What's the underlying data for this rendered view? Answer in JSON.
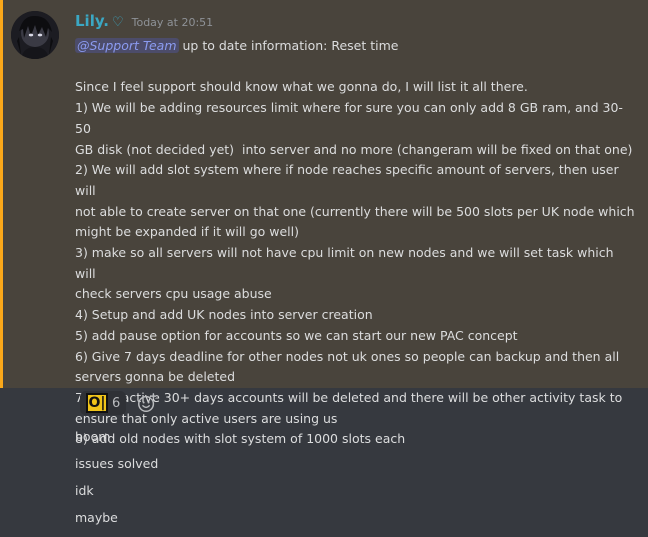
{
  "message": {
    "author": "Lily.",
    "timestamp": "Today at 20:51",
    "mention": "@Support Team",
    "first_line_rest": " up to date information: Reset time",
    "lines": [
      "",
      "Since I feel support should know what we gonna do, I will list it all there.",
      "1) We will be adding resources limit where for sure you can only add 8 GB ram, and 30-50",
      "GB disk (not decided yet)  into server and no more (changeram will be fixed on that one)",
      "2) We will add slot system where if node reaches specific amount of servers, then user will",
      "not able to create server on that one (currently there will be 500 slots per UK node which",
      "might be expanded if it will go well)",
      "3) make so all servers will not have cpu limit on new nodes and we will set task which will",
      "check servers cpu usage abuse",
      "4) Setup and add UK nodes into server creation",
      "5) add pause option for accounts so we can start our new PAC concept",
      "6) Give 7 days deadline for other nodes not uk ones so people can backup and then all",
      "servers gonna be deleted",
      "7) all inactive 30+ days accounts will be deleted and there will be other activity task to",
      "ensure that only active users are using us",
      "8) add old nodes with slot system of 1000 slots each"
    ]
  },
  "reaction": {
    "emoji_text": "O|",
    "count": "6"
  },
  "followups": [
    "boom",
    "issues solved",
    "idk",
    "maybe"
  ],
  "colors": {
    "username": "#3ba8c4",
    "mention_highlight": "#49443c",
    "mention_bar": "#faa81a",
    "background": "#36393f"
  }
}
